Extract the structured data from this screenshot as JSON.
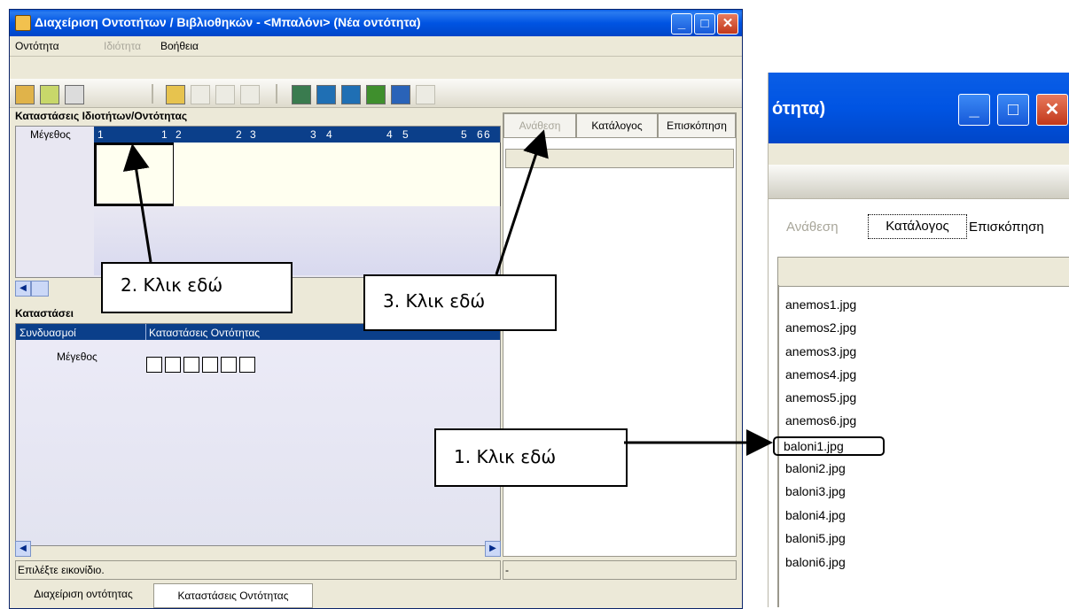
{
  "window": {
    "title": "Διαχείριση Οντοτήτων / Βιβλιοθηκών - <Μπαλόνι> (Νέα οντότητα)"
  },
  "zoom": {
    "title_fragment": "ότητα)"
  },
  "menu": [
    {
      "label": "Οντότητα"
    },
    {
      "label": "Ιδιότητα"
    },
    {
      "label": "Βοήθεια"
    }
  ],
  "toolbar_icons": [
    "new-icon",
    "open-icon",
    "save-icon",
    "exit-icon",
    "bulb-icon",
    "copy-icon",
    "delete-icon",
    "grid-icon",
    "add-icon",
    "remove-icon",
    "doc-icon",
    "globe-icon",
    "cancel-icon"
  ],
  "states_panel": {
    "title": "Καταστάσεις Ιδιοτήτων/Οντότητας",
    "row_label": "Μέγεθος",
    "columns": [
      "1",
      "1",
      "2",
      "2",
      "3",
      "3",
      "4",
      "4",
      "5",
      "5",
      "6",
      "6"
    ]
  },
  "combos_panel": {
    "title": "Καταστάσει",
    "col_combinations": "Συνδυασμοί",
    "col_states": "Καταστάσεις Οντότητας",
    "row_label": "Μέγεθος"
  },
  "tabs": {
    "assign": "Ανάθεση",
    "catalog": "Κατάλογος",
    "preview": "Επισκόπηση"
  },
  "file_list": [
    "anemos1.jpg",
    "anemos2.jpg",
    "anemos3.jpg",
    "anemos4.jpg",
    "anemos5.jpg",
    "anemos6.jpg",
    "baloni1.jpg",
    "baloni2.jpg",
    "baloni3.jpg",
    "baloni4.jpg",
    "baloni5.jpg",
    "baloni6.jpg"
  ],
  "status": {
    "text": "Επιλέξτε εικονίδιο.",
    "right": "-"
  },
  "bottom_tabs": [
    "Διαχείριση οντότητας",
    "Καταστάσεις Οντότητας"
  ],
  "callouts": {
    "one": "1. Κλικ εδώ",
    "two": "2. Κλικ εδώ",
    "three": "3. Κλικ εδώ"
  },
  "colors": {
    "titlebar": "#0054e3",
    "grid_header": "#0b3f8a",
    "panel_bg": "#ece9d8"
  }
}
